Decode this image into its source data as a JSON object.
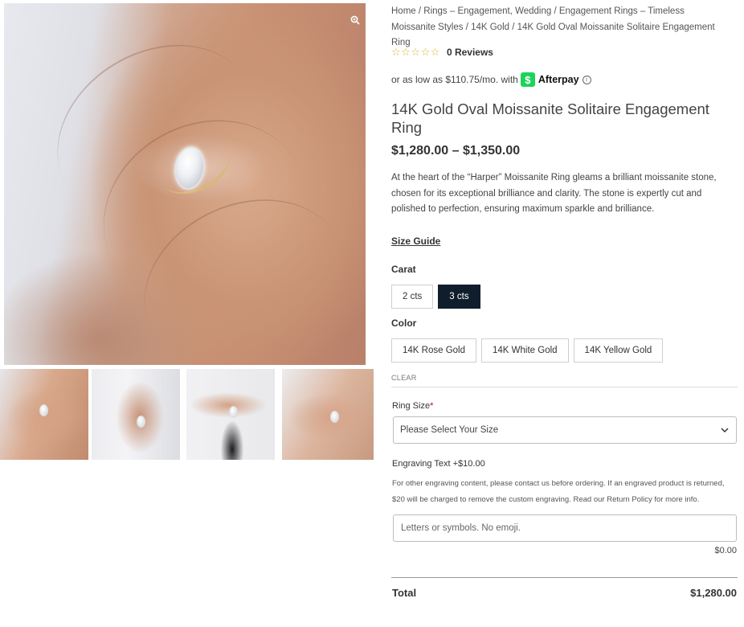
{
  "gallery": {
    "main_image_alt": "Hand wearing oval moissanite solitaire ring",
    "zoom_icon": "zoom-icon",
    "thumbnails": [
      {
        "alt": "Ring on hand, angled view"
      },
      {
        "alt": "Ring on hand against white blazer"
      },
      {
        "alt": "Hands with ring against white blazer and black top"
      },
      {
        "alt": "Ring on hand, side view"
      }
    ]
  },
  "breadcrumb": {
    "items": [
      "Home",
      "Rings – Engagement, Wedding",
      "Engagement Rings – Timeless Moissanite Styles",
      "14K Gold"
    ],
    "separator": " / ",
    "current": "14K Gold Oval Moissanite Solitaire Engagement Ring"
  },
  "rating": {
    "stars": 0,
    "max": 5,
    "reviews_label": "0 Reviews",
    "star_color": "#d9b530"
  },
  "afterpay": {
    "prefix": "or as low as $110.75/mo. with",
    "logo_glyph": "$",
    "name": "Afterpay",
    "info_glyph": "i",
    "brand_color": "#1fd25c"
  },
  "product": {
    "title": "14K Gold Oval Moissanite Solitaire Engagement Ring",
    "price_range": "$1,280.00 – $1,350.00",
    "description": "At the heart of the “Harper” Moissanite Ring gleams a brilliant moissanite stone, chosen for its exceptional brilliance and clarity. The stone is expertly cut and polished to perfection, ensuring maximum sparkle and brilliance."
  },
  "size_guide_label": "Size Guide",
  "carat": {
    "label": "Carat",
    "options": [
      "2 cts",
      "3 cts"
    ],
    "selected": "3 cts",
    "selected_color": "#101d2d"
  },
  "color": {
    "label": "Color",
    "options": [
      "14K Rose Gold",
      "14K White Gold",
      "14K Yellow Gold"
    ]
  },
  "clear_label": "CLEAR",
  "ring_size": {
    "label": "Ring Size",
    "required_mark": "*",
    "value": "Please Select Your Size"
  },
  "engraving": {
    "label": "Engraving Text +$10.00",
    "note": "For other engraving content, please contact us before ordering. If an engraved product is returned, $20 will be charged to remove the custom engraving. Read our Return Policy for more info.",
    "placeholder": "Letters or symbols. No emoji.",
    "price": "$0.00"
  },
  "total": {
    "label": "Total",
    "value": "$1,280.00"
  }
}
